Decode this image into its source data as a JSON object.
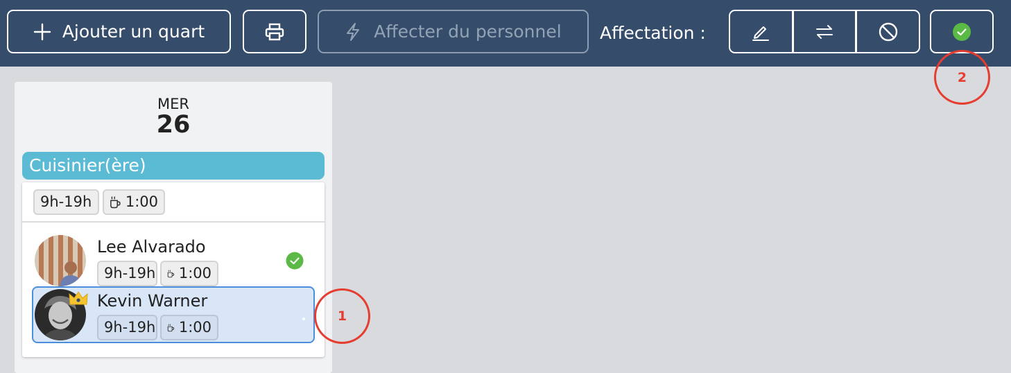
{
  "toolbar": {
    "add_shift_label": "Ajouter un quart",
    "assign_staff_label": "Affecter du personnel",
    "assignment_label": "Affectation :"
  },
  "day": {
    "weekday": "MER",
    "date": "26"
  },
  "role": {
    "name": "Cuisinier(ère)",
    "color": "#5bbbd5"
  },
  "shift": {
    "hours": "9h-19h",
    "break": "1:00"
  },
  "employees": [
    {
      "name": "Lee Alvarado",
      "hours": "9h-19h",
      "break": "1:00",
      "status": "confirmed"
    },
    {
      "name": "Kevin Warner",
      "hours": "9h-19h",
      "break": "1:00",
      "status": "selected"
    }
  ],
  "annotations": [
    "1",
    "2"
  ],
  "colors": {
    "toolbar_bg": "#354d6a",
    "confirmed_green": "#5bb946",
    "selection_blue": "#4a8fd9",
    "annotation_red": "#e53d2f",
    "crown_yellow": "#f4c430"
  },
  "icons": [
    "plus-icon",
    "printer-icon",
    "lightning-icon",
    "pencil-icon",
    "swap-icon",
    "ban-icon",
    "check-circle-icon",
    "coffee-icon",
    "crown-icon"
  ]
}
